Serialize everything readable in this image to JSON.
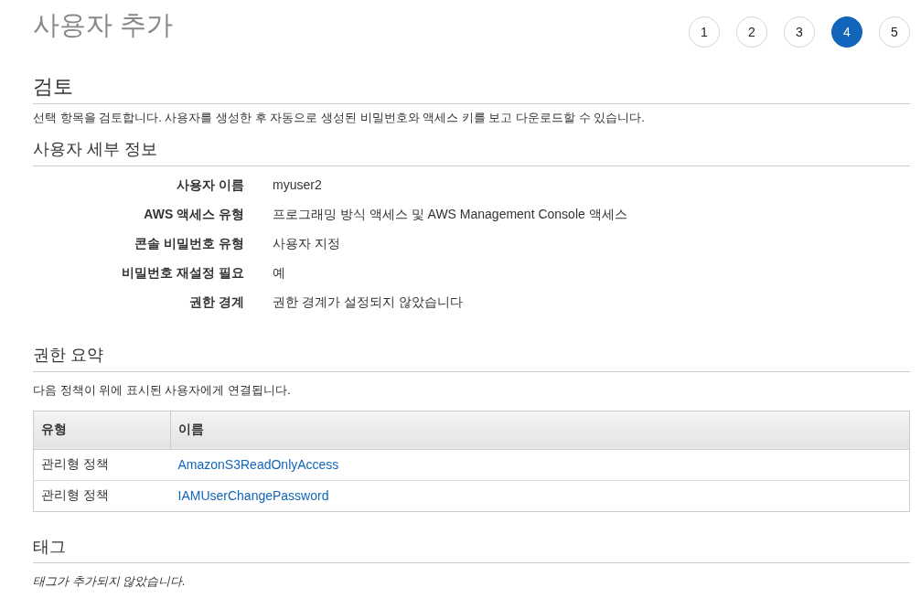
{
  "page_title": "사용자 추가",
  "steps": [
    {
      "label": "1",
      "selected": false
    },
    {
      "label": "2",
      "selected": false
    },
    {
      "label": "3",
      "selected": false
    },
    {
      "label": "4",
      "selected": true
    },
    {
      "label": "5",
      "selected": false
    }
  ],
  "review": {
    "heading": "검토",
    "description": "선택 항목을 검토합니다. 사용자를 생성한 후 자동으로 생성된 비밀번호와 액세스 키를 보고 다운로드할 수 있습니다."
  },
  "user_details": {
    "heading": "사용자 세부 정보",
    "fields": [
      {
        "label": "사용자 이름",
        "value": "myuser2"
      },
      {
        "label": "AWS 액세스 유형",
        "value": "프로그래밍 방식 액세스 및 AWS Management Console 액세스"
      },
      {
        "label": "콘솔 비밀번호 유형",
        "value": "사용자 지정"
      },
      {
        "label": "비밀번호 재설정 필요",
        "value": "예"
      },
      {
        "label": "권한 경계",
        "value": "권한 경계가 설정되지 않았습니다"
      }
    ]
  },
  "permissions": {
    "heading": "권한 요약",
    "description": "다음 정책이 위에 표시된 사용자에게 연결됩니다.",
    "columns": [
      "유형",
      "이름"
    ],
    "rows": [
      {
        "type": "관리형 정책",
        "name": "AmazonS3ReadOnlyAccess"
      },
      {
        "type": "관리형 정책",
        "name": "IAMUserChangePassword"
      }
    ]
  },
  "tags": {
    "heading": "태그",
    "message": "태그가 추가되지 않았습니다."
  }
}
